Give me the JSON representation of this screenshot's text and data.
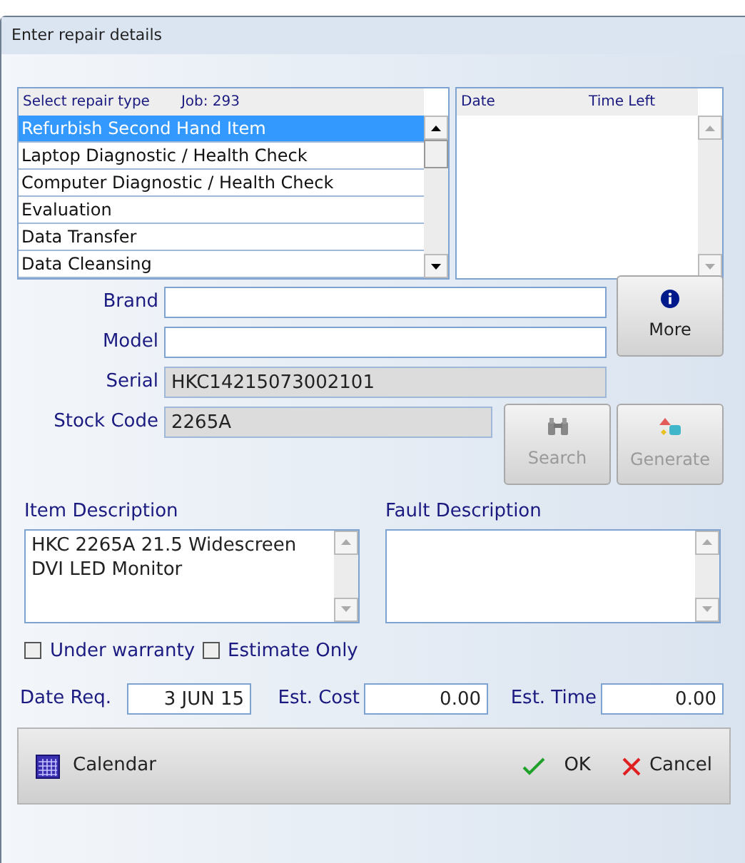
{
  "window": {
    "title": "Enter repair details"
  },
  "repair_list": {
    "header": "Select repair type",
    "job": "Job: 293",
    "items": [
      {
        "label": "Refurbish Second Hand Item",
        "selected": true
      },
      {
        "label": "Laptop Diagnostic / Health Check",
        "selected": false
      },
      {
        "label": "Computer Diagnostic / Health Check",
        "selected": false
      },
      {
        "label": "Evaluation",
        "selected": false
      },
      {
        "label": "Data Transfer",
        "selected": false
      },
      {
        "label": "Data Cleansing",
        "selected": false
      }
    ]
  },
  "schedule_list": {
    "columns": [
      "Date",
      "Time Left"
    ]
  },
  "fields": [
    {
      "label": "Brand",
      "disabled": false
    },
    {
      "label": "Model",
      "disabled": false
    },
    {
      "label": "Serial",
      "value": "HKC14215073002101",
      "disabled": true
    },
    {
      "label": "Stock Code",
      "value": "2265A",
      "disabled": true
    }
  ],
  "more_button": {
    "label": "More",
    "disabled": false
  },
  "search_button": {
    "label": "Search",
    "disabled": true
  },
  "generate_button": {
    "label": "Generate",
    "disabled": true
  },
  "item_description": {
    "label": "Item Description",
    "value": "HKC 2265A 21.5 Widescreen\nDVI LED Monitor"
  },
  "fault_description": {
    "label": "Fault Description"
  },
  "checkboxes": [
    {
      "label": "Under warranty",
      "checked": false
    },
    {
      "label": "Estimate Only",
      "checked": false
    }
  ],
  "date_req": {
    "label": "Date Req.",
    "value": "3 JUN 15"
  },
  "est_cost": {
    "label": "Est. Cost",
    "value": "0.00"
  },
  "est_time": {
    "label": "Est. Time",
    "value": "0.00"
  },
  "footer": {
    "calendar": "Calendar",
    "ok": "OK",
    "cancel": "Cancel"
  }
}
